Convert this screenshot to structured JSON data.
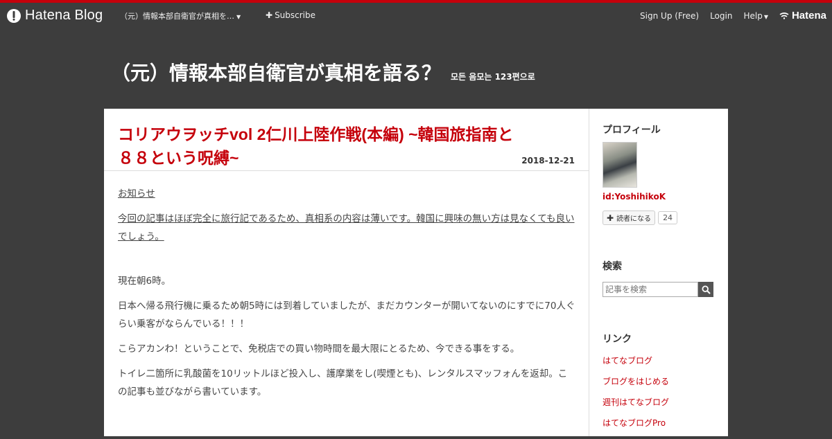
{
  "globalbar": {
    "logo_text": "Hatena Blog",
    "blog_menu": "（元）情報本部自衛官が真相を…",
    "subscribe": "Subscribe",
    "signup": "Sign Up (Free)",
    "login": "Login",
    "help": "Help",
    "hatena": "Hatena"
  },
  "blog": {
    "title": "（元）情報本部自衛官が真相を語る？",
    "description": "모든 음모는 123편으로"
  },
  "entry": {
    "title": "コリアウヲッチvol 2仁川上陸作戦(本編) ~韓国旅指南と８８という呪縛~",
    "date": "2018-12-21",
    "paragraphs": [
      "お知らせ",
      "今回の記事はほぼ完全に旅行記であるため、真相系の内容は薄いです。韓国に興味の無い方は見なくても良いでしょう。",
      "現在朝6時。",
      "日本へ帰る飛行機に乗るため朝5時には到着していましたが、まだカウンターが開いてないのにすでに70人ぐらい乗客がならんでいる！！！",
      "こらアカンわ！ということで、免税店での買い物時間を最大限にとるため、今できる事をする。",
      "トイレ二箇所に乳酸菌を10リットルほど投入し、護摩業をし(喫煙とも)、レンタルスマッフォんを返却。この記事も並びながら書いています。"
    ]
  },
  "sidebar": {
    "profile_title": "プロフィール",
    "profile_id": "id:YoshihikoK",
    "follow_label": "読者になる",
    "follow_count": "24",
    "search_title": "検索",
    "search_placeholder": "記事を検索",
    "links_title": "リンク",
    "links": [
      "はてなブログ",
      "ブログをはじめる",
      "週刊はてなブログ",
      "はてなブログPro"
    ]
  },
  "colors": {
    "accent": "#c5000b",
    "background": "#3d3d3d"
  },
  "icons": [
    "hatena-blog-logo-icon",
    "plus-icon",
    "chevron-down-icon",
    "hatena-logo-icon",
    "search-icon"
  ]
}
